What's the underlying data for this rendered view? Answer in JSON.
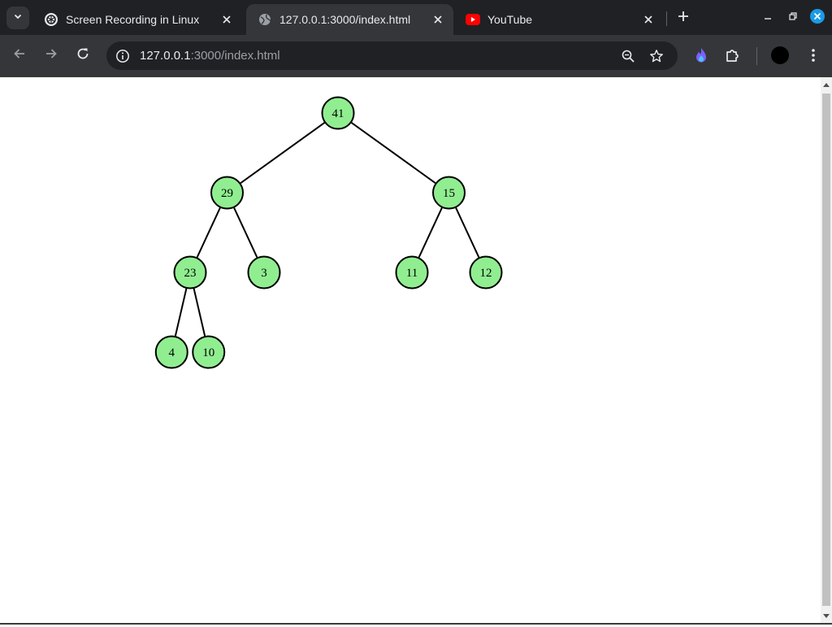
{
  "browser": {
    "tabs": [
      {
        "title": "Screen Recording in Linux",
        "icon": "chatgpt-icon",
        "active": false
      },
      {
        "title": "127.0.0.1:3000/index.html",
        "icon": "globe-icon",
        "active": true
      },
      {
        "title": "YouTube",
        "icon": "youtube-icon",
        "active": false
      }
    ],
    "url_host": "127.0.0.1",
    "url_rest": ":3000/index.html"
  },
  "tree": {
    "node_color": "#90ee90",
    "nodes": [
      {
        "id": "n41",
        "value": "41",
        "children": [
          "n29",
          "n15"
        ]
      },
      {
        "id": "n29",
        "value": "29",
        "children": [
          "n23",
          "n3"
        ]
      },
      {
        "id": "n15",
        "value": "15",
        "children": [
          "n11",
          "n12"
        ]
      },
      {
        "id": "n23",
        "value": "23",
        "children": [
          "n4",
          "n10"
        ]
      },
      {
        "id": "n3",
        "value": "3",
        "children": []
      },
      {
        "id": "n11",
        "value": "11",
        "children": []
      },
      {
        "id": "n12",
        "value": "12",
        "children": []
      },
      {
        "id": "n4",
        "value": "4",
        "children": []
      },
      {
        "id": "n10",
        "value": "10",
        "children": []
      }
    ]
  }
}
